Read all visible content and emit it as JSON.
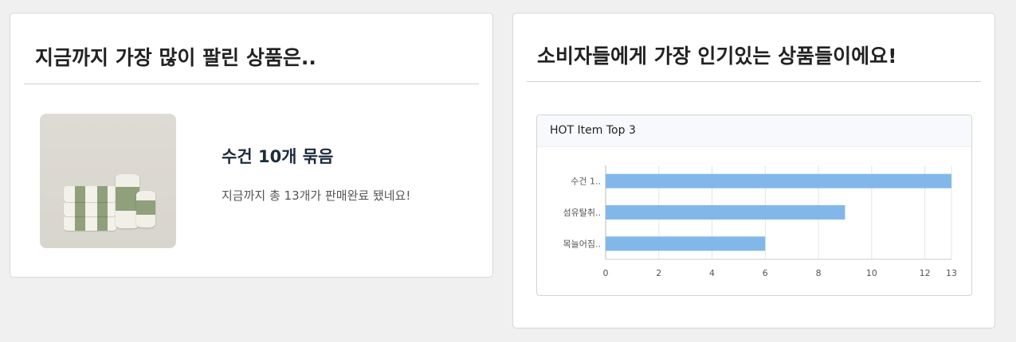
{
  "best_seller": {
    "title": "지금까지 가장 많이 팔린 상품은..",
    "product_name": "수건 10개 묶음",
    "description": "지금까지 총 13개가 판매완료 됐네요!"
  },
  "popular": {
    "title": "소비자들에게 가장 인기있는 상품들이에요!",
    "panel_title": "HOT Item Top 3"
  },
  "chart_data": {
    "type": "bar",
    "orientation": "horizontal",
    "categories": [
      "수건 1..",
      "섬유탈취..",
      "목늘어짐.."
    ],
    "values": [
      13,
      9,
      6
    ],
    "xlim": [
      0,
      13
    ],
    "x_ticks": [
      0,
      2,
      4,
      6,
      8,
      10,
      12,
      13
    ],
    "grid": true,
    "bar_color": "#82b8e9"
  },
  "colors": {
    "background": "#f0f0f0",
    "card": "#ffffff",
    "title": "#222222",
    "product_name": "#1d2b3d",
    "bar": "#82b8e9",
    "accent_green": "#8fa07a"
  }
}
